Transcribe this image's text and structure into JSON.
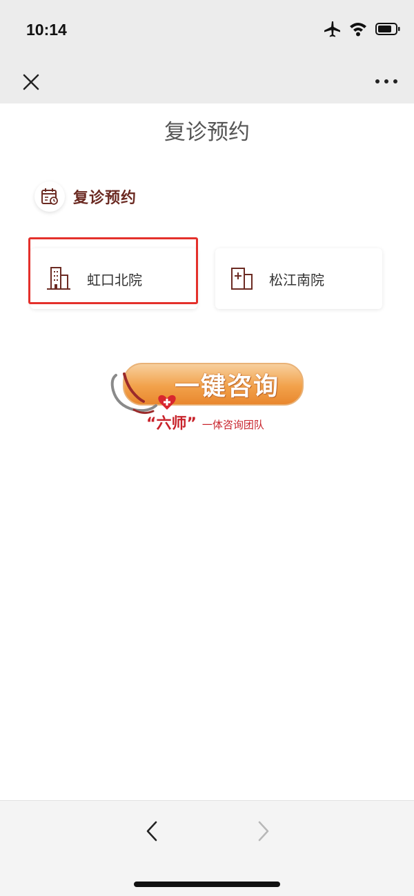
{
  "status_bar": {
    "time": "10:14",
    "icons": [
      "airplane-icon",
      "wifi-icon",
      "battery-icon"
    ]
  },
  "nav": {
    "close_icon": "close-icon",
    "more_icon": "more-icon"
  },
  "page": {
    "title": "复诊预约"
  },
  "section": {
    "title": "复诊预约",
    "icon": "calendar-icon"
  },
  "hospitals": [
    {
      "label": "虹口北院",
      "icon": "building-icon",
      "highlighted": true
    },
    {
      "label": "松江南院",
      "icon": "hospital-icon",
      "highlighted": false
    }
  ],
  "consult": {
    "button_label": "一键咨询",
    "team_name": "“六师”",
    "team_suffix": "一体咨询团队"
  },
  "colors": {
    "accent": "#6b2a22",
    "highlight": "#e4302b",
    "consult_orange": "#f2a24b",
    "team_red": "#c8232b"
  },
  "bottom_nav": {
    "back_icon": "chevron-left-icon",
    "forward_icon": "chevron-right-icon"
  }
}
